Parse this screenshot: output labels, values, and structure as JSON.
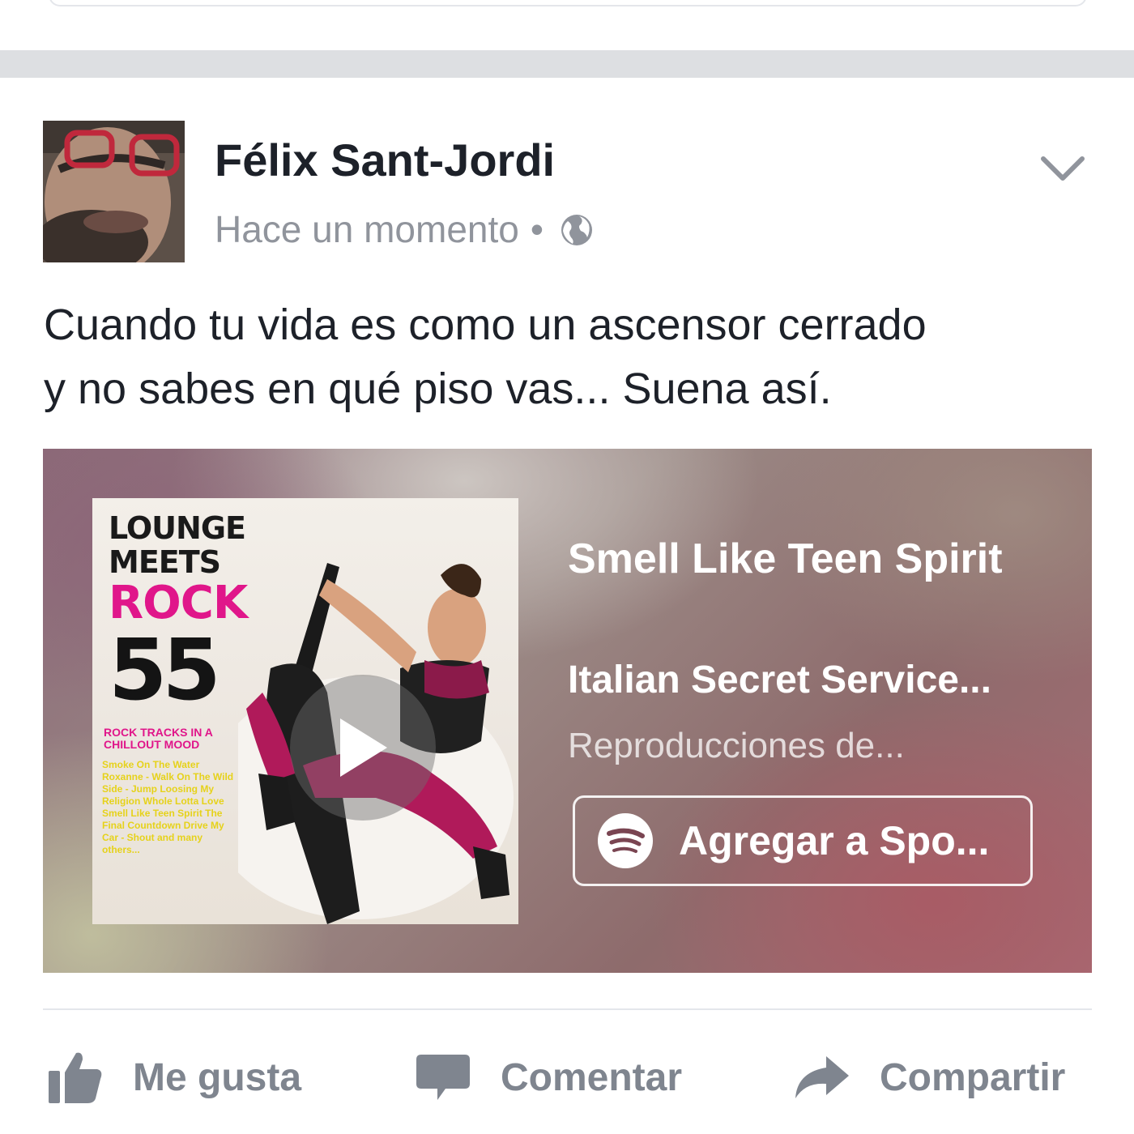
{
  "post": {
    "author": "Félix Sant-Jordi",
    "timestamp": "Hace un momento",
    "separator": "•",
    "privacy_icon": "globe-icon",
    "menu_icon": "chevron-down-icon",
    "text_line1": "Cuando tu vida es como un ascensor cerrado",
    "text_line2": "y no sabes en qué piso vas... Suena así."
  },
  "music_card": {
    "cover": {
      "line1": "LOUNGE",
      "line2": "MEETS",
      "line3": "ROCK",
      "line4": "55",
      "subtitle": "ROCK TRACKS IN A CHILLOUT MOOD",
      "tracks": "Smoke On The Water Roxanne - Walk On The Wild Side - Jump Loosing My Religion Whole Lotta Love Smell Like Teen Spirit The Final Countdown Drive My Car - Shout and many others..."
    },
    "title": "Smell Like Teen Spirit",
    "artist": "Italian Secret Service...",
    "plays": "Reproducciones de...",
    "add_button": "Agregar a Spo...",
    "brand_icon": "spotify-icon",
    "play_icon": "play-icon"
  },
  "actions": {
    "like": "Me gusta",
    "comment": "Comentar",
    "share": "Compartir"
  },
  "colors": {
    "text_primary": "#1d2129",
    "text_secondary": "#90949c",
    "action_gray": "#7f858f",
    "separator": "#dddfe2",
    "accent_pink": "#e0168a"
  }
}
